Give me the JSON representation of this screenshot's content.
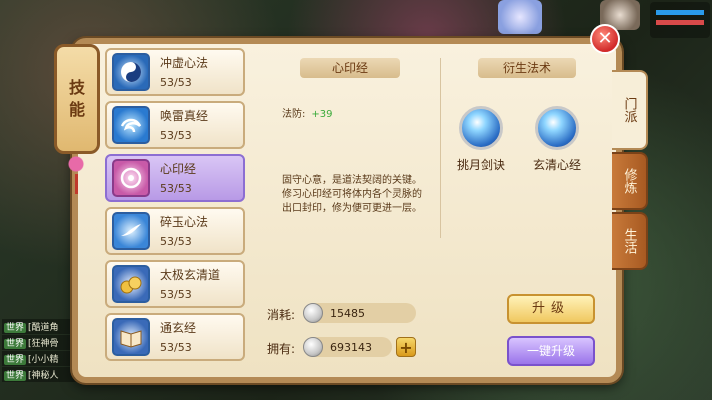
{
  "side_title": [
    "技",
    "能"
  ],
  "skills": [
    {
      "name": "冲虚心法",
      "level": "53/53",
      "icon": "taiji-icon",
      "color": "#2a6ab8"
    },
    {
      "name": "唤雷真经",
      "level": "53/53",
      "icon": "thunder-swirl-icon",
      "color": "#2a7ad0"
    },
    {
      "name": "心印经",
      "level": "53/53",
      "icon": "pink-seal-icon",
      "color": "#c85aa8"
    },
    {
      "name": "碎玉心法",
      "level": "53/53",
      "icon": "jade-swirl-icon",
      "color": "#3a86d8"
    },
    {
      "name": "太极玄清道",
      "level": "53/53",
      "icon": "coins-icon",
      "color": "#d8a030"
    },
    {
      "name": "通玄经",
      "level": "53/53",
      "icon": "book-icon",
      "color": "#8a5aa8"
    }
  ],
  "detail": {
    "header": "心印经",
    "stat_label": "法防:",
    "stat_value": "+39",
    "description": "固守心意，是道法契阔的关键。修习心印经可将体内各个灵脉的出口封印，修为便可更进一层。"
  },
  "derived": {
    "header": "衍生法术",
    "skills": [
      {
        "name": "挑月剑诀",
        "icon": "moon-sword-icon"
      },
      {
        "name": "玄清心经",
        "icon": "mystic-heart-icon"
      }
    ]
  },
  "resources": {
    "cost_label": "消耗:",
    "cost_value": "15485",
    "own_label": "拥有:",
    "own_value": "693143",
    "plus": "+"
  },
  "buttons": {
    "upgrade": "升级",
    "one_key_upgrade": "一键升级"
  },
  "tabs": [
    {
      "label": "门派",
      "active": true
    },
    {
      "label": "修炼",
      "active": false
    },
    {
      "label": "生活",
      "active": false
    }
  ],
  "close": "✕",
  "chat": [
    {
      "channel": "世界",
      "text": "[酷道角"
    },
    {
      "channel": "世界",
      "text": "[狂神骨"
    },
    {
      "channel": "世界",
      "text": "[小小精"
    },
    {
      "channel": "世界",
      "text": "[神秘人"
    }
  ]
}
